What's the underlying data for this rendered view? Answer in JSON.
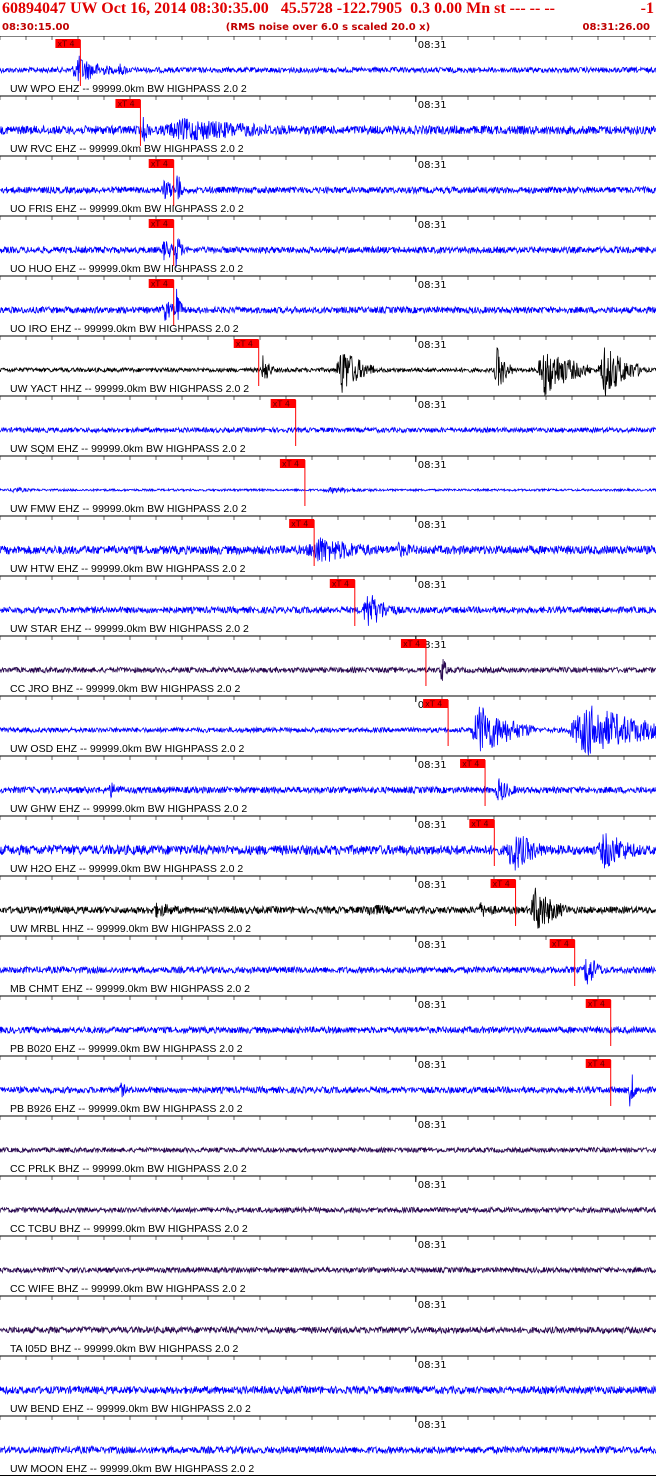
{
  "header": {
    "title": "60894047 UW Oct 16, 2014 08:30:35.00   45.5728 -122.7905  0.3 0.00 Mn st --- -- --",
    "right_value": "-1",
    "start_time": "08:30:15.00",
    "noise_note": "(RMS noise over 6.0 s scaled 20.0 x)",
    "end_time": "08:31:26.00"
  },
  "chart_data": {
    "type": "line",
    "title": "60894047 UW Oct 16, 2014 08:30:35.00   45.5728 -122.7905  0.3 0.00 Mn st --- -- --",
    "time_start": "08:30:15.00",
    "time_end": "08:31:26.00",
    "minute_mark_label": "08:31",
    "minute_mark_seconds": 45,
    "duration_seconds": 71,
    "pick_label": "xT 4",
    "colors": {
      "blue": "#0000ff",
      "black": "#000000",
      "purple": "#2a0a50",
      "red": "#e00000",
      "pick": "#ff0000"
    },
    "channels": [
      {
        "label": "UW WPO EHZ -- 99999.0km BW  HIGHPASS  2.0  2",
        "pick_s": 8.7,
        "color": "blue",
        "noise": 0.1,
        "bursts": [
          [
            8.5,
            3.2,
            0.55
          ],
          [
            13.0,
            1.5,
            0.25
          ]
        ]
      },
      {
        "label": "UW RVC EHZ -- 99999.0km BW  HIGHPASS  2.0  2",
        "pick_s": 15.2,
        "color": "blue",
        "noise": 0.16,
        "bursts": [
          [
            20.0,
            14.0,
            0.45
          ],
          [
            15.5,
            1.0,
            0.5
          ]
        ]
      },
      {
        "label": "UO FRIS EHZ -- 99999.0km BW  HIGHPASS  2.0  2",
        "pick_s": 18.8,
        "color": "blue",
        "noise": 0.12,
        "bursts": [
          [
            17.8,
            1.5,
            0.45
          ],
          [
            19.1,
            0.5,
            1.0
          ]
        ]
      },
      {
        "label": "UO HUO EHZ -- 99999.0km BW  HIGHPASS  2.0  2",
        "pick_s": 18.8,
        "color": "blue",
        "noise": 0.12,
        "bursts": [
          [
            17.8,
            1.5,
            0.45
          ],
          [
            19.1,
            0.5,
            1.0
          ]
        ]
      },
      {
        "label": "UO IRO EHZ -- 99999.0km BW  HIGHPASS  2.0  2",
        "pick_s": 18.8,
        "color": "blue",
        "noise": 0.12,
        "bursts": [
          [
            17.8,
            1.5,
            0.45
          ],
          [
            19.1,
            0.5,
            1.0
          ]
        ]
      },
      {
        "label": "UW YACT HHZ -- 99999.0km BW  HIGHPASS  2.0  2",
        "pick_s": 28.0,
        "color": "black",
        "noise": 0.08,
        "bursts": [
          [
            28.5,
            0.8,
            0.7
          ],
          [
            37.0,
            2.5,
            0.95
          ],
          [
            53.8,
            1.2,
            0.9
          ],
          [
            59.0,
            3.5,
            1.0
          ],
          [
            65.5,
            3.0,
            1.0
          ]
        ]
      },
      {
        "label": "UW SQM EHZ -- 99999.0km BW  HIGHPASS  2.0  2",
        "pick_s": 32.0,
        "color": "blue",
        "noise": 0.09,
        "bursts": []
      },
      {
        "label": "UW FMW EHZ -- 99999.0km BW  HIGHPASS  2.0  2",
        "pick_s": 33.0,
        "color": "blue",
        "noise": 0.04,
        "bursts": [
          [
            1.5,
            2.5,
            0.12
          ],
          [
            36.0,
            6.0,
            0.12
          ]
        ]
      },
      {
        "label": "UW HTW EHZ -- 99999.0km BW  HIGHPASS  2.0  2",
        "pick_s": 34.0,
        "color": "blue",
        "noise": 0.16,
        "bursts": [
          [
            34.5,
            6.5,
            0.55
          ],
          [
            43.0,
            4.0,
            0.3
          ]
        ]
      },
      {
        "label": "UW STAR EHZ -- 99999.0km BW  HIGHPASS  2.0  2",
        "pick_s": 38.4,
        "color": "blue",
        "noise": 0.12,
        "bursts": [
          [
            39.8,
            2.5,
            0.75
          ]
        ]
      },
      {
        "label": "CC JRO BHZ -- 99999.0km BW  HIGHPASS  2.0  2",
        "pick_s": 46.1,
        "color": "purple",
        "noise": 0.1,
        "bursts": [
          [
            47.8,
            0.6,
            0.65
          ]
        ]
      },
      {
        "label": "UW OSD EHZ -- 99999.0km BW  HIGHPASS  2.0  2",
        "pick_s": 48.5,
        "color": "blue",
        "noise": 0.09,
        "bursts": [
          [
            52.0,
            4.2,
            1.0
          ],
          [
            63.5,
            8.0,
            1.0
          ]
        ]
      },
      {
        "label": "UW GHW EHZ -- 99999.0km BW  HIGHPASS  2.0  2",
        "pick_s": 52.5,
        "color": "blue",
        "noise": 0.12,
        "bursts": [
          [
            12.0,
            2.0,
            0.3
          ],
          [
            54.0,
            1.8,
            0.5
          ]
        ]
      },
      {
        "label": "UW H2O EHZ -- 99999.0km BW  HIGHPASS  2.0  2",
        "pick_s": 53.5,
        "color": "blue",
        "noise": 0.18,
        "bursts": [
          [
            55.5,
            3.0,
            0.85
          ],
          [
            65.5,
            3.5,
            0.75
          ]
        ]
      },
      {
        "label": "UW MRBL HHZ -- 99999.0km BW  HIGHPASS  2.0  2",
        "pick_s": 55.8,
        "color": "black",
        "noise": 0.13,
        "bursts": [
          [
            17.0,
            4.0,
            0.3
          ],
          [
            40.0,
            5.0,
            0.25
          ],
          [
            52.0,
            3.0,
            0.3
          ],
          [
            58.0,
            2.5,
            0.95
          ]
        ]
      },
      {
        "label": "MB CHMT EHZ -- 99999.0km BW  HIGHPASS  2.0  2",
        "pick_s": 62.2,
        "color": "blue",
        "noise": 0.12,
        "bursts": [
          [
            63.5,
            1.5,
            0.7
          ]
        ]
      },
      {
        "label": "PB B020 EHZ -- 99999.0km BW  HIGHPASS  2.0  2",
        "pick_s": 66.1,
        "color": "blue",
        "noise": 0.12,
        "bursts": []
      },
      {
        "label": "PB B926 EHZ -- 99999.0km BW  HIGHPASS  2.0  2",
        "pick_s": 66.1,
        "color": "blue",
        "noise": 0.12,
        "bursts": [
          [
            13.0,
            1.0,
            0.35
          ],
          [
            68.2,
            0.5,
            1.0
          ]
        ]
      },
      {
        "label": "CC PRLK BHZ -- 99999.0km BW  HIGHPASS  2.0  2",
        "color": "purple",
        "noise": 0.09,
        "bursts": []
      },
      {
        "label": "CC TCBU BHZ -- 99999.0km BW  HIGHPASS  2.0  2",
        "color": "purple",
        "noise": 0.1,
        "bursts": []
      },
      {
        "label": "CC WIFE BHZ -- 99999.0km BW  HIGHPASS  2.0  2",
        "color": "purple",
        "noise": 0.1,
        "bursts": []
      },
      {
        "label": "TA I05D BHZ -- 99999.0km BW  HIGHPASS  2.0  2",
        "color": "purple",
        "noise": 0.12,
        "bursts": []
      },
      {
        "label": "UW BEND EHZ -- 99999.0km BW  HIGHPASS  2.0  2",
        "color": "blue",
        "noise": 0.14,
        "bursts": []
      },
      {
        "label": "UW MOON EHZ -- 99999.0km BW  HIGHPASS  2.0  2",
        "color": "blue",
        "noise": 0.13,
        "bursts": []
      }
    ]
  }
}
